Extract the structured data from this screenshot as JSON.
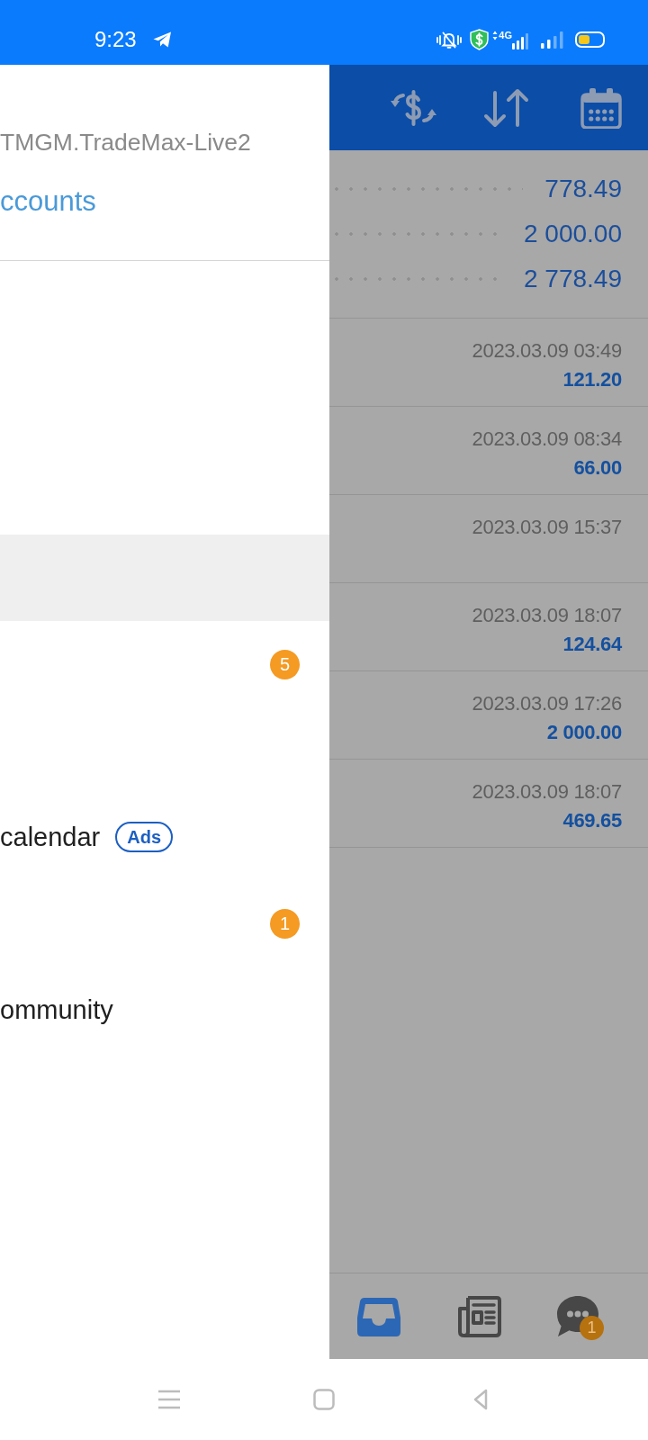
{
  "status_bar": {
    "time": "9:23",
    "network": "4G"
  },
  "drawer": {
    "server": "TMGM.TradeMax-Live2",
    "accounts_link": "ccounts",
    "items": [
      {
        "selected": true
      },
      {
        "selected": false,
        "badge": "5"
      },
      {
        "selected": false,
        "label": "calendar",
        "tag": "Ads"
      },
      {
        "selected": false,
        "badge": "1"
      },
      {
        "selected": false,
        "label": "ommunity"
      }
    ]
  },
  "summary": [
    {
      "value": "778.49"
    },
    {
      "value": "2 000.00"
    },
    {
      "value": "2 778.49"
    }
  ],
  "deals": [
    {
      "time": "2023.03.09 03:49",
      "amount": "121.20"
    },
    {
      "time": "2023.03.09 08:34",
      "amount": "66.00"
    },
    {
      "time": "2023.03.09 15:37"
    },
    {
      "time": "2023.03.09 18:07",
      "amount": "124.64"
    },
    {
      "time": "2023.03.09 17:26",
      "amount": "2 000.00"
    },
    {
      "time": "2023.03.09 18:07",
      "amount": "469.65"
    }
  ],
  "bottom_tabs": [
    {
      "kind": "inbox",
      "selected": true
    },
    {
      "kind": "news",
      "selected": false
    },
    {
      "kind": "chat",
      "selected": false,
      "badge": "1"
    }
  ]
}
